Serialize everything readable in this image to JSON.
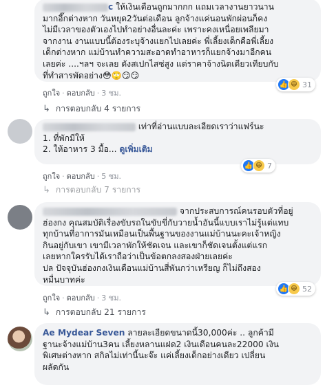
{
  "comment1": {
    "name_visible": "c",
    "lines": [
      "ให้เงินเดือนถูกมากกก แถมเวลางานยาวนาน",
      "มากอี๊กต่างหาก วันหยุด2วันต่อเดือน ลูกจ้างแค่นอนพักผ่อนก็คง",
      "ไม่มีเวลาของตัวเองไปทำอย่างอื่นละค่ะ เพราะคงเหนื่อยเพลียมา",
      "จากงาน งานแบบนี้ต้องระบุจ้างแยกไปเลยค่ะ พี่เลี้ยงเด็กคือพี่เลี้ยง",
      "เด็กต่างหาก แม่บ้านทำความสะอาดทำอาหารก็แยกจ้างมาอีกคน",
      "เลยค่ะ ....ฯลฯ จะเลย ดังสเปกไสซ่สูง แต่ราคาจ้างนิดเดียวเทียบกับ",
      "ที่ทำสารพัดอย่าง😳🙄😏😏"
    ],
    "like_label": "ถูกใจ",
    "reply_label": "ตอบกลับ",
    "time": "3 ชม.",
    "reaction_count": "31",
    "replies_label": "การตอบกลับ 4 รายการ"
  },
  "comment2": {
    "lines_head": "เท่าที่อ่านแบบละเอียดเราว่าแฟร์นะ",
    "lines": [
      "1. ที่พักมีให้"
    ],
    "last_line": "2. ให้อาหาร 3 มื้อ...",
    "see_more": "ดูเพิ่มเติม",
    "like_label": "ถูกใจ",
    "reply_label": "ตอบกลับ",
    "time": "5 ชม.",
    "reaction_count": "7",
    "replies_label": "การตอบกลับ 7 รายการ"
  },
  "comment3": {
    "lines_head": "จากประสบการณ์คนรอบตัวที่อยู่",
    "lines": [
      "ฮ่องกง คุณสมบัติเรื่องขับรถในขับขี่กับวายน้ำอันนี้แบบเราไม่รู้แต่แทบ",
      "ทุกบ้านที่อาการมันเหมือนเป็นพื้นฐานของงานแม่บ้านนะคะเจ้าหญิง",
      "กินอยู่กับเขา เขามีเวลาพักให้ชัดเจน และเขาก็ชัดเจนตั้งแต่แรก",
      "เลยหากใครรับได้เราถือว่าเป็นข้อตกลงสองฝ่ายเลยค่ะ",
      "ปล ปัจจุบันฮ่องกงเงินเดือนแม่บ้านสี่พันกว่าเหรียญ ก็ไม่ถึงสอง",
      "หมื่นบาทค่ะ"
    ],
    "like_label": "ถูกใจ",
    "reply_label": "ตอบกลับ",
    "time": "3 ชม.",
    "reaction_count": "52",
    "replies_label": "การตอบกลับ 21 รายการ"
  },
  "comment4": {
    "name": "Ae Mydear Seven",
    "first_line": "ลายละเอียดขนาดนี้30,000ค่ะ .. ลูกค้ามี",
    "lines": [
      "ฐานะจ้างแม่บ้าน3คน เลี้ยงหลานแฝด2 เงินเดือนคนละ22000 เงิน",
      "พิเศษต่างหาก สกิลไม่เท่านี้นะจ๊ะ แค่เลี้ยงเด็กอย่างเดียว เปลี่ยน",
      "ผลัดกัน"
    ]
  }
}
